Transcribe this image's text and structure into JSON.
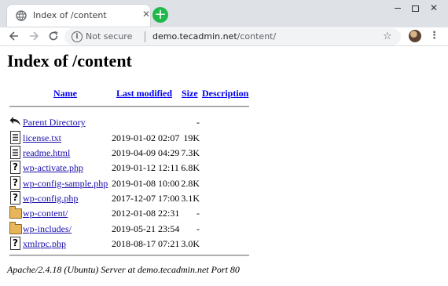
{
  "browser": {
    "tab_title": "Index of /content",
    "close_glyph": "✕",
    "new_tab_glyph": "+",
    "not_secure": "Not secure",
    "url_host": "demo.tecadmin.net",
    "url_path": "/content/"
  },
  "page": {
    "title": "Index of /content",
    "columns": {
      "name": "Name",
      "last_modified": "Last modified",
      "size": "Size",
      "description": "Description"
    },
    "entries": [
      {
        "name": "Parent Directory",
        "date": "",
        "size": "-",
        "icon": "back-icon"
      },
      {
        "name": "license.txt",
        "date": "2019-01-02 02:07",
        "size": "19K",
        "icon": "text-file-icon"
      },
      {
        "name": "readme.html",
        "date": "2019-04-09 04:29",
        "size": "7.3K",
        "icon": "text-file-icon"
      },
      {
        "name": "wp-activate.php",
        "date": "2019-01-12 12:11",
        "size": "6.8K",
        "icon": "unknown-file-icon"
      },
      {
        "name": "wp-config-sample.php",
        "date": "2019-01-08 10:00",
        "size": "2.8K",
        "icon": "unknown-file-icon"
      },
      {
        "name": "wp-config.php",
        "date": "2017-12-07 17:00",
        "size": "3.1K",
        "icon": "unknown-file-icon"
      },
      {
        "name": "wp-content/",
        "date": "2012-01-08 22:31",
        "size": "-",
        "icon": "folder-icon"
      },
      {
        "name": "wp-includes/",
        "date": "2019-05-21 23:54",
        "size": "-",
        "icon": "folder-icon"
      },
      {
        "name": "xmlrpc.php",
        "date": "2018-08-17 07:21",
        "size": "3.0K",
        "icon": "unknown-file-icon"
      }
    ],
    "address": "Apache/2.4.18 (Ubuntu) Server at demo.tecadmin.net Port 80"
  },
  "colors": {
    "link": "#1a0dab",
    "header_link": "#0000ee",
    "new_tab_button": "#1fb84a",
    "tab_strip": "#dee1e6"
  }
}
